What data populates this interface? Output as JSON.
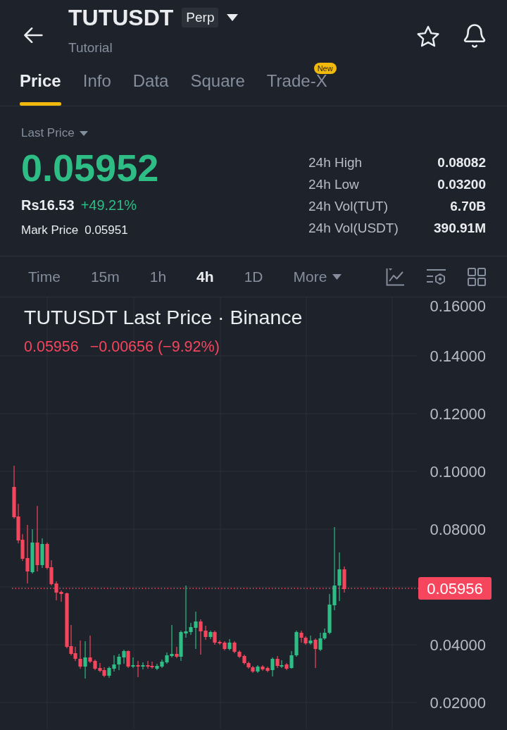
{
  "header": {
    "title": "TUTUSDT",
    "badge": "Perp",
    "subtitle": "Tutorial"
  },
  "tabs": [
    {
      "label": "Price",
      "selected": true
    },
    {
      "label": "Info",
      "selected": false
    },
    {
      "label": "Data",
      "selected": false
    },
    {
      "label": "Square",
      "selected": false
    },
    {
      "label": "Trade-X",
      "selected": false,
      "badge": "New"
    }
  ],
  "ticker": {
    "price_type": "Last Price",
    "price": "0.05952",
    "fiat_price": "Rs16.53",
    "change": "+49.21%",
    "mark_price_label": "Mark Price",
    "mark_price": "0.05951",
    "stats": [
      {
        "label": "24h High",
        "value": "0.08082"
      },
      {
        "label": "24h Low",
        "value": "0.03200"
      },
      {
        "label": "24h Vol(TUT)",
        "value": "6.70B"
      },
      {
        "label": "24h Vol(USDT)",
        "value": "390.91M"
      }
    ]
  },
  "intervals": [
    {
      "label": "Time",
      "selected": false,
      "kind": "interval"
    },
    {
      "label": "15m",
      "selected": false,
      "kind": "interval"
    },
    {
      "label": "1h",
      "selected": false,
      "kind": "interval"
    },
    {
      "label": "4h",
      "selected": true,
      "kind": "interval"
    },
    {
      "label": "1D",
      "selected": false,
      "kind": "interval"
    },
    {
      "label": "More",
      "selected": false,
      "kind": "dropdown"
    }
  ],
  "chart": {
    "title": "TUTUSDT Last Price · Binance",
    "last_value": "0.05956",
    "change": "−0.00656 (−9.92%)",
    "y_axis_labels": [
      "0.16000",
      "0.14000",
      "0.12000",
      "0.10000",
      "0.08000",
      "0.04000",
      "0.02000"
    ],
    "price_tag": "0.05956"
  }
}
